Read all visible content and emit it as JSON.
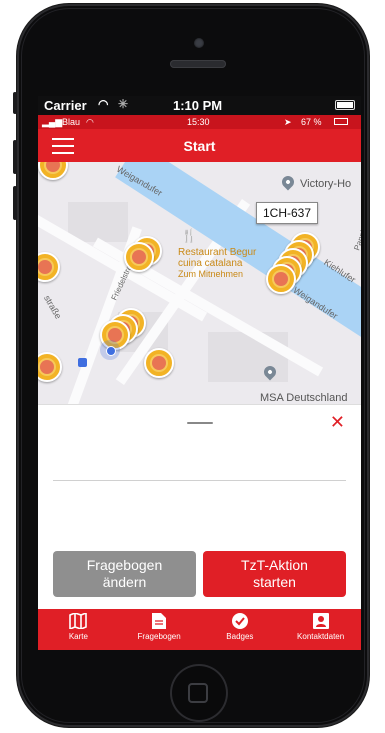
{
  "ios_status": {
    "carrier": "Carrier",
    "time": "1:10 PM"
  },
  "android_status": {
    "carrier": "Blau",
    "time": "15:30",
    "battery": "67 %"
  },
  "header": {
    "title": "Start"
  },
  "map": {
    "labels": {
      "street_top": "Weigandufer",
      "street_left": "straße",
      "street_mid": "Friedelstraße",
      "street_right": "Weigandufer",
      "kiehl": "Kiehlufer",
      "pannier": "Pannierstraße"
    },
    "poi": {
      "name_line1": "Restaurant Begur",
      "name_line2": "cuina catalana",
      "sub": "Zum Mitnehmen"
    },
    "places": {
      "victory": "Victory-Ho",
      "msa": "MSA Deutschland"
    },
    "selected_tag": "1CH-637"
  },
  "sheet": {
    "close_symbol": "✕",
    "btn_secondary": {
      "line1": "Fragebogen",
      "line2": "ändern"
    },
    "btn_primary": {
      "line1": "TzT-Aktion",
      "line2": "starten"
    }
  },
  "tabs": [
    {
      "label": "Karte",
      "icon": "map-icon"
    },
    {
      "label": "Fragebogen",
      "icon": "document-icon"
    },
    {
      "label": "Badges",
      "icon": "badge-icon"
    },
    {
      "label": "Kontaktdaten",
      "icon": "contact-icon"
    }
  ],
  "colors": {
    "accent": "#e01f26",
    "marker": "#f2b325",
    "grey_button": "#8f8f8f"
  }
}
